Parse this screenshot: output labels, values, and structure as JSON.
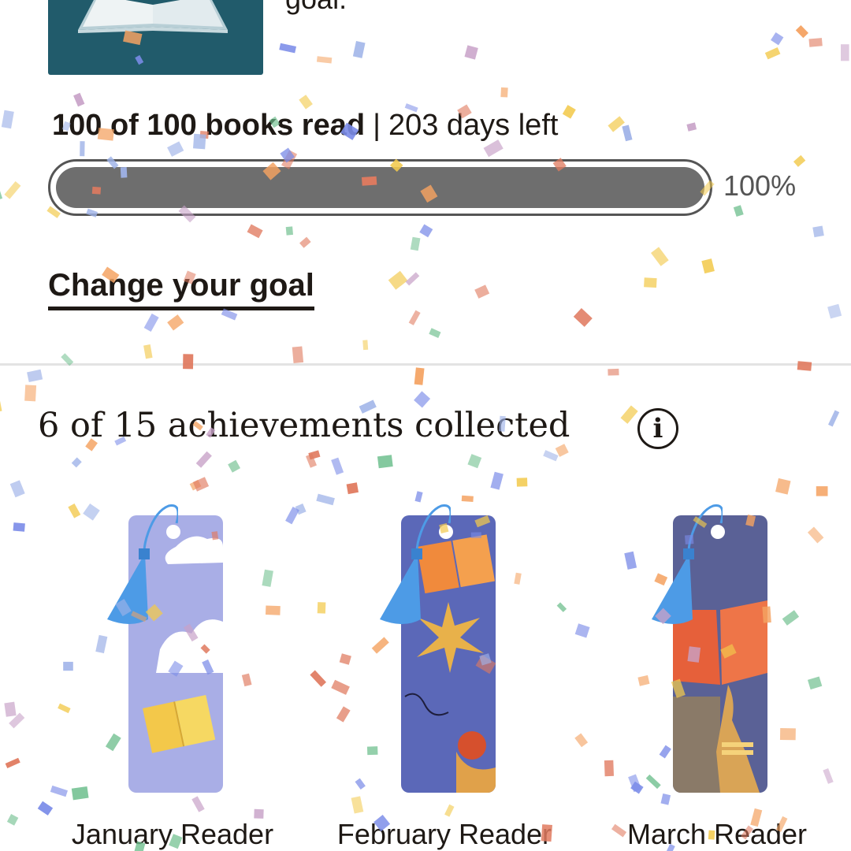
{
  "goal": {
    "text_fragment": "goal."
  },
  "stats": {
    "books_read": "100 of 100 books read",
    "separator": "|",
    "days_left": "203 days left"
  },
  "progress": {
    "percent_label": "100%",
    "fraction": 1.0
  },
  "change_goal_label": "Change your goal",
  "achievements": {
    "title": "6 of 15 achievements collected",
    "info_symbol": "i",
    "items": [
      {
        "label": "January Reader",
        "color": "#a9aee6"
      },
      {
        "label": "February Reader",
        "color": "#5b68b8"
      },
      {
        "label": "March Reader",
        "color": "#5a6196"
      }
    ]
  },
  "colors": {
    "cover": "#215b6b",
    "tassel": "#4d9be6",
    "progress_fill": "#6e6e6e"
  },
  "icons": {
    "cover": "open-book-icon",
    "info": "info-icon"
  }
}
